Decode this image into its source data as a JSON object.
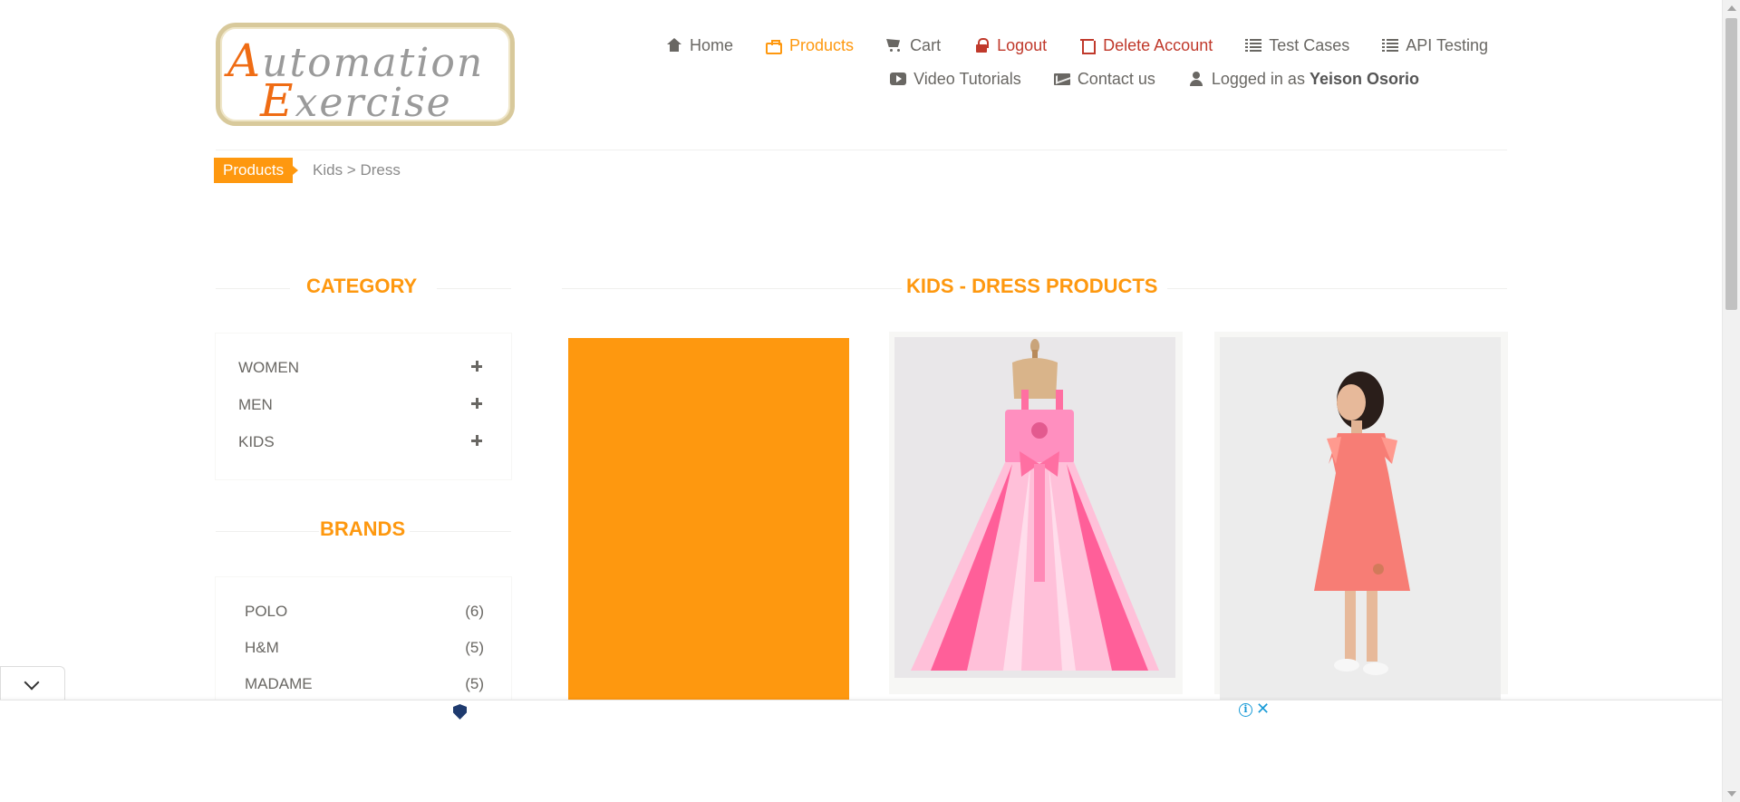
{
  "logo": {
    "line1_cap": "A",
    "line1_rest": "utomation",
    "line2_cap": "E",
    "line2_rest": "xercise"
  },
  "nav": {
    "row1": [
      {
        "label": "Home",
        "icon": "home-icon"
      },
      {
        "label": "Products",
        "icon": "briefcase-icon",
        "active": true
      },
      {
        "label": "Cart",
        "icon": "cart-icon"
      },
      {
        "label": "Logout",
        "icon": "lock-icon"
      },
      {
        "label": "Delete Account",
        "icon": "trash-icon"
      },
      {
        "label": "Test Cases",
        "icon": "list-icon"
      },
      {
        "label": "API Testing",
        "icon": "list-icon"
      }
    ],
    "row2": [
      {
        "label": "Video Tutorials",
        "icon": "youtube-icon"
      },
      {
        "label": "Contact us",
        "icon": "envelope-icon"
      },
      {
        "label": "Logged in as",
        "icon": "user-icon",
        "user": "Yeison Osorio"
      }
    ]
  },
  "breadcrumb": {
    "active": "Products",
    "rest": "Kids > Dress"
  },
  "sidebar": {
    "category_title": "Category",
    "categories": [
      "WOMEN",
      "MEN",
      "KIDS"
    ],
    "brands_title": "Brands",
    "brands": [
      {
        "name": "POLO",
        "count": "(6)"
      },
      {
        "name": "H&M",
        "count": "(5)"
      },
      {
        "name": "MADAME",
        "count": "(5)"
      }
    ]
  },
  "main": {
    "title": "Kids - Dress Products"
  },
  "colors": {
    "accent": "#fe980f",
    "danger": "#c0392b",
    "text": "#696763"
  },
  "ad": {
    "info_icon": "info-icon",
    "close_icon": "close-icon"
  }
}
